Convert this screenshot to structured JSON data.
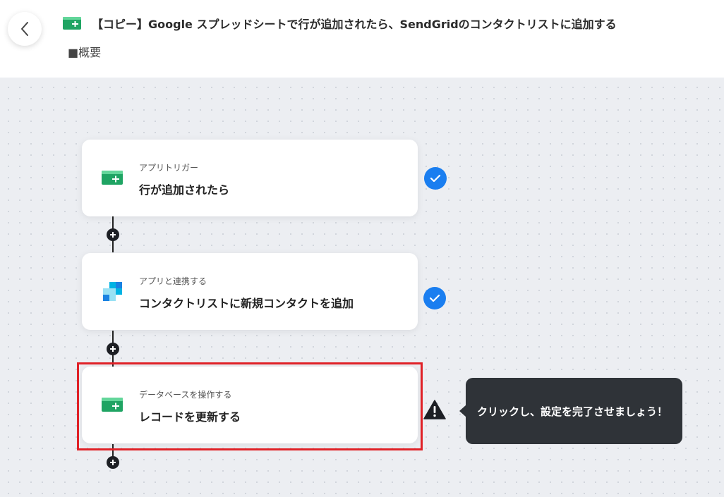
{
  "header": {
    "title": "【コピー】Google スプレッドシートで行が追加されたら、SendGridのコンタクトリストに追加する",
    "summary": "■概要"
  },
  "steps": [
    {
      "sub": "アプリトリガー",
      "main": "行が追加されたら",
      "icon": "google-sheets-icon",
      "status": "complete"
    },
    {
      "sub": "アプリと連携する",
      "main": "コンタクトリストに新規コンタクトを追加",
      "icon": "sendgrid-icon",
      "status": "complete"
    },
    {
      "sub": "データベースを操作する",
      "main": "レコードを更新する",
      "icon": "google-sheets-icon",
      "status": "incomplete"
    }
  ],
  "tooltip": {
    "text": "クリックし、設定を完了させましょう！"
  },
  "colors": {
    "accent": "#1a7ef0",
    "highlight": "#e02127",
    "sheets_green": "#1fa463",
    "tooltip_bg": "#2f3338",
    "canvas_bg": "#eceef2"
  }
}
